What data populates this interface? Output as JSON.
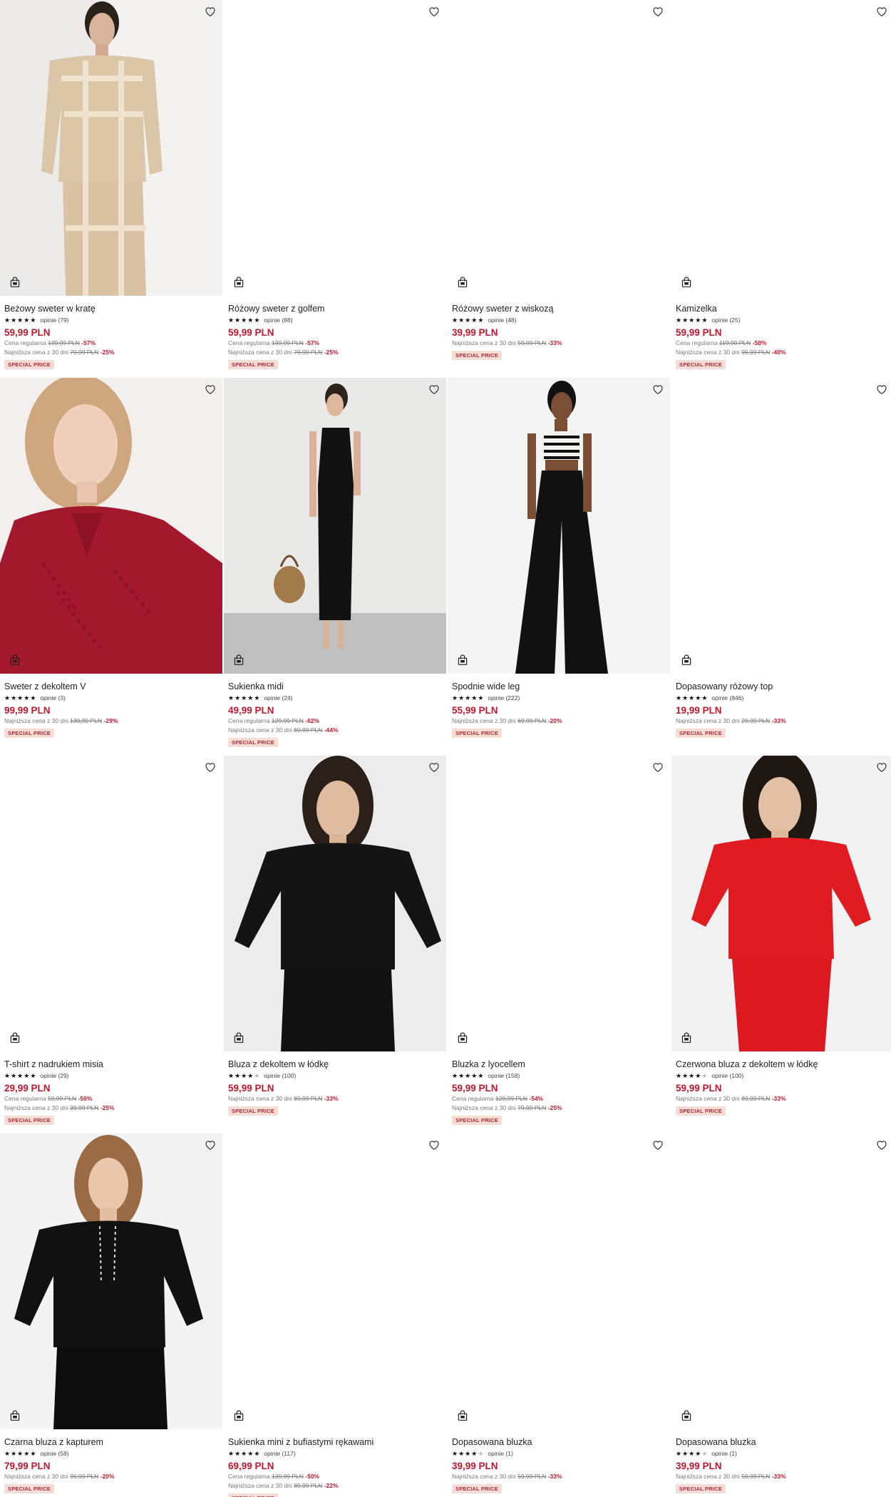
{
  "icons": {
    "favorite": "heart-outline-icon",
    "cart": "shopping-bag-icon"
  },
  "colors": {
    "price": "#c0182d",
    "badge_bg": "#f6ddd6",
    "badge_text": "#b0293a"
  },
  "products": [
    {
      "name": "Beżowy sweter w kratę",
      "stars": 4.5,
      "reviews": "opinie (79)",
      "price": "59,99 PLN",
      "lines": [
        {
          "label": "Cena regularna",
          "old": "139,99 PLN",
          "disc": "-57%"
        },
        {
          "label": "Najniższa cena z 30 dni",
          "old": "79,99 PLN",
          "disc": "-25%"
        }
      ],
      "badge": "SPECIAL PRICE",
      "image": "beige"
    },
    {
      "name": "Różowy sweter z golfem",
      "stars": 5,
      "reviews": "opinie (88)",
      "price": "59,99 PLN",
      "lines": [
        {
          "label": "Cena regularna",
          "old": "139,99 PLN",
          "disc": "-57%"
        },
        {
          "label": "Najniższa cena z 30 dni",
          "old": "79,99 PLN",
          "disc": "-25%"
        }
      ],
      "badge": "SPECIAL PRICE",
      "image": "blank"
    },
    {
      "name": "Różowy sweter z wiskozą",
      "stars": 5,
      "reviews": "opinie (48)",
      "price": "39,99 PLN",
      "lines": [
        {
          "label": "Najniższa cena z 30 dni",
          "old": "59,99 PLN",
          "disc": "-33%"
        }
      ],
      "badge": "SPECIAL PRICE",
      "image": "blank"
    },
    {
      "name": "Kamizelka",
      "stars": 4.5,
      "reviews": "opinie (25)",
      "price": "59,99 PLN",
      "lines": [
        {
          "label": "Cena regularna",
          "old": "119,99 PLN",
          "disc": "-50%"
        },
        {
          "label": "Najniższa cena z 30 dni",
          "old": "99,99 PLN",
          "disc": "-40%"
        }
      ],
      "badge": "SPECIAL PRICE",
      "image": "blank"
    },
    {
      "name": "Sweter z dekoltem V",
      "stars": 5,
      "reviews": "opinie (3)",
      "price": "99,99 PLN",
      "lines": [
        {
          "label": "Najniższa cena z 30 dni",
          "old": "139,99 PLN",
          "disc": "-29%"
        }
      ],
      "badge": "SPECIAL PRICE",
      "image": "burgundy"
    },
    {
      "name": "Sukienka midi",
      "stars": 5,
      "reviews": "opinie (24)",
      "price": "49,99 PLN",
      "lines": [
        {
          "label": "Cena regularna",
          "old": "129,99 PLN",
          "disc": "-62%"
        },
        {
          "label": "Najniższa cena z 30 dni",
          "old": "89,99 PLN",
          "disc": "-44%"
        }
      ],
      "badge": "SPECIAL PRICE",
      "image": "dress"
    },
    {
      "name": "Spodnie wide leg",
      "stars": 4.5,
      "reviews": "opinie (222)",
      "price": "55,99 PLN",
      "lines": [
        {
          "label": "Najniższa cena z 30 dni",
          "old": "69,99 PLN",
          "disc": "-20%"
        }
      ],
      "badge": "SPECIAL PRICE",
      "image": "wideleg"
    },
    {
      "name": "Dopasowany różowy top",
      "stars": 5,
      "reviews": "opinie (846)",
      "price": "19,99 PLN",
      "lines": [
        {
          "label": "Najniższa cena z 30 dni",
          "old": "29,99 PLN",
          "disc": "-33%"
        }
      ],
      "badge": "SPECIAL PRICE",
      "image": "blank"
    },
    {
      "name": "T-shirt z nadrukiem misia",
      "stars": 4.5,
      "reviews": "opinie (29)",
      "price": "29,99 PLN",
      "lines": [
        {
          "label": "Cena regularna",
          "old": "59,99 PLN",
          "disc": "-50%"
        },
        {
          "label": "Najniższa cena z 30 dni",
          "old": "39,99 PLN",
          "disc": "-25%"
        }
      ],
      "badge": "SPECIAL PRICE",
      "image": "blank"
    },
    {
      "name": "Bluza z dekoltem w łódkę",
      "stars": 4,
      "reviews": "opinie (100)",
      "price": "59,99 PLN",
      "lines": [
        {
          "label": "Najniższa cena z 30 dni",
          "old": "89,99 PLN",
          "disc": "-33%"
        }
      ],
      "badge": "SPECIAL PRICE",
      "image": "blacktop"
    },
    {
      "name": "Bluzka z lyocellem",
      "stars": 4.5,
      "reviews": "opinie (158)",
      "price": "59,99 PLN",
      "lines": [
        {
          "label": "Cena regularna",
          "old": "129,99 PLN",
          "disc": "-54%"
        },
        {
          "label": "Najniższa cena z 30 dni",
          "old": "79,99 PLN",
          "disc": "-25%"
        }
      ],
      "badge": "SPECIAL PRICE",
      "image": "blank"
    },
    {
      "name": "Czerwona bluza z dekoltem w łódkę",
      "stars": 4,
      "reviews": "opinie (100)",
      "price": "59,99 PLN",
      "lines": [
        {
          "label": "Najniższa cena z 30 dni",
          "old": "89,99 PLN",
          "disc": "-33%"
        }
      ],
      "badge": "SPECIAL PRICE",
      "image": "red"
    },
    {
      "name": "Czarna bluza z kapturem",
      "stars": 5,
      "reviews": "opinie (58)",
      "price": "79,99 PLN",
      "lines": [
        {
          "label": "Najniższa cena z 30 dni",
          "old": "99,99 PLN",
          "disc": "-20%"
        }
      ],
      "badge": "SPECIAL PRICE",
      "image": "hoodie"
    },
    {
      "name": "Sukienka mini z bufiastymi rękawami",
      "stars": 4.5,
      "reviews": "opinie (117)",
      "price": "69,99 PLN",
      "lines": [
        {
          "label": "Cena regularna",
          "old": "139,99 PLN",
          "disc": "-50%"
        },
        {
          "label": "Najniższa cena z 30 dni",
          "old": "89,99 PLN",
          "disc": "-22%"
        }
      ],
      "badge": "SPECIAL PRICE",
      "image": "blank"
    },
    {
      "name": "Dopasowana bluzka",
      "stars": 4,
      "reviews": "opinie (1)",
      "price": "39,99 PLN",
      "lines": [
        {
          "label": "Najniższa cena z 30 dni",
          "old": "59,99 PLN",
          "disc": "-33%"
        }
      ],
      "badge": "SPECIAL PRICE",
      "image": "blank"
    },
    {
      "name": "Dopasowana bluzka",
      "stars": 4,
      "reviews": "opinie (1)",
      "price": "39,99 PLN",
      "lines": [
        {
          "label": "Najniższa cena z 30 dni",
          "old": "59,99 PLN",
          "disc": "-33%"
        }
      ],
      "badge": "SPECIAL PRICE",
      "image": "blank"
    }
  ]
}
